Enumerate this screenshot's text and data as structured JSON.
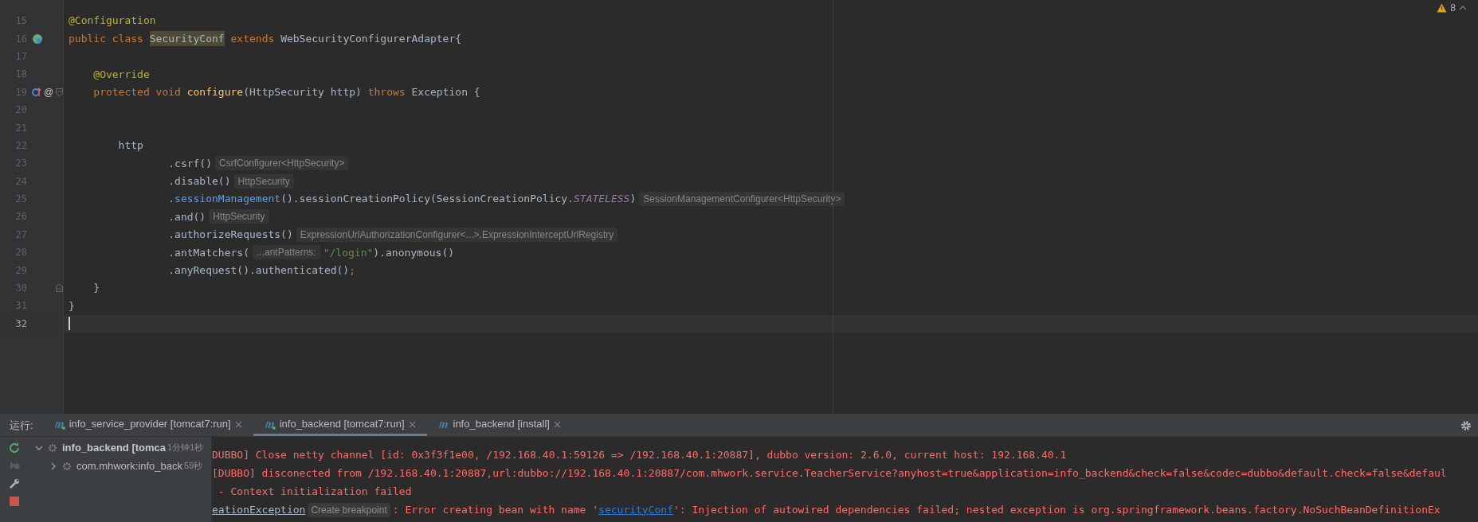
{
  "editor": {
    "warnings": {
      "count": "8"
    },
    "lines": [
      {
        "number": "15",
        "segments": [
          {
            "kind": "ann",
            "text": "@Configuration"
          }
        ]
      },
      {
        "number": "16",
        "gutter": [
          {
            "kind": "bean"
          }
        ],
        "segments": [
          {
            "kind": "kw",
            "text": "public class "
          },
          {
            "kind": "class-hl",
            "text": "SecurityConf"
          },
          {
            "kind": "kw",
            "text": " extends "
          },
          {
            "kind": "plain",
            "text": "WebSecurityConfigurerAdapter{"
          }
        ]
      },
      {
        "number": "17"
      },
      {
        "number": "18",
        "segments": [
          {
            "kind": "ann",
            "text": "    @Override"
          }
        ]
      },
      {
        "number": "19",
        "gutter": [
          {
            "kind": "override"
          },
          {
            "kind": "text",
            "text": "@"
          }
        ],
        "fold": {
          "kind": "start"
        },
        "segments": [
          {
            "kind": "kw",
            "text": "    protected void "
          },
          {
            "kind": "decl",
            "text": "configure"
          },
          {
            "kind": "plain",
            "text": "(HttpSecurity http) "
          },
          {
            "kind": "kw",
            "text": "throws "
          },
          {
            "kind": "plain",
            "text": "Exception {"
          }
        ]
      },
      {
        "number": "20"
      },
      {
        "number": "21"
      },
      {
        "number": "22",
        "segments": [
          {
            "kind": "plain",
            "text": "        http"
          }
        ]
      },
      {
        "number": "23",
        "segments": [
          {
            "kind": "plain",
            "text": "                .csrf()"
          },
          {
            "kind": "hint",
            "text": "CsrfConfigurer<HttpSecurity>"
          }
        ]
      },
      {
        "number": "24",
        "segments": [
          {
            "kind": "plain",
            "text": "                .disable()"
          },
          {
            "kind": "hint",
            "text": "HttpSecurity"
          }
        ]
      },
      {
        "number": "25",
        "segments": [
          {
            "kind": "plain",
            "text": "                ."
          },
          {
            "kind": "call",
            "text": "sessionManagement"
          },
          {
            "kind": "plain",
            "text": "().sessionCreationPolicy(SessionCreationPolicy."
          },
          {
            "kind": "const",
            "text": "STATELESS"
          },
          {
            "kind": "plain",
            "text": ")"
          },
          {
            "kind": "hint",
            "text": "SessionManagementConfigurer<HttpSecurity>"
          }
        ]
      },
      {
        "number": "26",
        "segments": [
          {
            "kind": "plain",
            "text": "                .and()"
          },
          {
            "kind": "hint",
            "text": "HttpSecurity"
          }
        ]
      },
      {
        "number": "27",
        "segments": [
          {
            "kind": "plain",
            "text": "                .authorizeRequests()"
          },
          {
            "kind": "hint",
            "text": "ExpressionUrlAuthorizationConfigurer<...>.ExpressionInterceptUrlRegistry"
          }
        ]
      },
      {
        "number": "28",
        "segments": [
          {
            "kind": "plain",
            "text": "                .antMatchers("
          },
          {
            "kind": "hint",
            "text": "...antPatterns:"
          },
          {
            "kind": "str",
            "text": "\"/login\""
          },
          {
            "kind": "plain",
            "text": ").anonymous()"
          }
        ]
      },
      {
        "number": "29",
        "segments": [
          {
            "kind": "plain",
            "text": "                .anyRequest().authenticated()"
          },
          {
            "kind": "kw",
            "text": ";"
          }
        ]
      },
      {
        "number": "30",
        "fold": {
          "kind": "end"
        },
        "segments": [
          {
            "kind": "plain",
            "text": "    }"
          }
        ]
      },
      {
        "number": "31",
        "segments": [
          {
            "kind": "plain",
            "text": "}"
          }
        ]
      },
      {
        "number": "32",
        "current": true
      }
    ]
  },
  "run_panel": {
    "label": "运行:",
    "tabs": [
      {
        "label": "info_service_provider [tomcat7:run]",
        "running": true,
        "selected": false
      },
      {
        "label": "info_backend [tomcat7:run]",
        "running": true,
        "selected": true
      },
      {
        "label": "info_backend [install]",
        "running": false,
        "selected": false
      }
    ],
    "tree": [
      {
        "label": "info_backend [tomca",
        "time": "1分钟1秒",
        "expanded": true,
        "children": [
          {
            "label": "com.mhwork:info_back",
            "time": "59秒",
            "expanded": false
          }
        ]
      }
    ],
    "console": [
      [
        {
          "kind": "err",
          "text": "DUBBO] Close netty channel [id: 0x3f3f1e00, /192.168.40.1:59126 => /192.168.40.1:20887], dubbo version: 2.6.0, current host: 192.168.40.1"
        }
      ],
      [
        {
          "kind": "err",
          "text": "[DUBBO] disconected from /192.168.40.1:20887,url:dubbo://192.168.40.1:20887/com.mhwork.service.TeacherService?anyhost=true&application=info_backend&check=false&codec=dubbo&default.check=false&defaul"
        }
      ],
      [
        {
          "kind": "err",
          "text": " - Context initialization failed"
        }
      ],
      [
        {
          "kind": "class-link",
          "text": "eationException"
        },
        {
          "kind": "hint",
          "text": "Create breakpoint"
        },
        {
          "kind": "err",
          "text": ": Error creating bean with name '"
        },
        {
          "kind": "link",
          "text": "securityConf"
        },
        {
          "kind": "err",
          "text": "': Injection of autowired dependencies failed; nested exception is org.springframework.beans.factory.NoSuchBeanDefinitionEx"
        }
      ]
    ]
  }
}
